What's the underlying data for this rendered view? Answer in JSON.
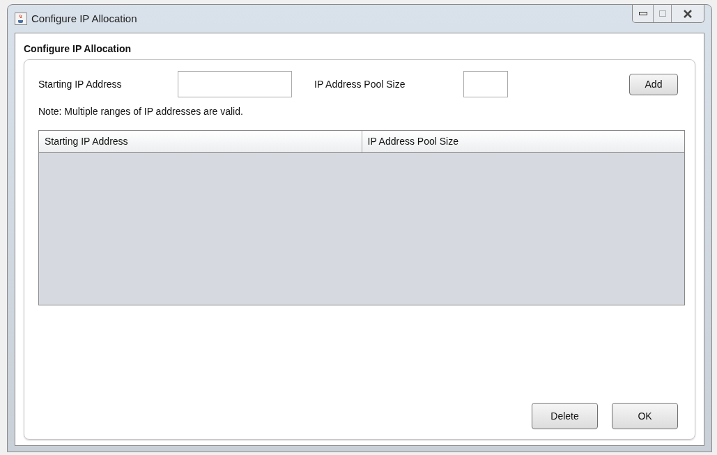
{
  "window": {
    "title": "Configure IP Allocation"
  },
  "panel": {
    "title": "Configure IP Allocation"
  },
  "form": {
    "start_label": "Starting IP Address",
    "pool_label": "IP Address Pool Size",
    "add_button": "Add",
    "note": "Note: Multiple ranges of IP addresses are valid."
  },
  "table": {
    "columns": [
      "Starting IP Address",
      "IP Address Pool Size"
    ]
  },
  "buttons": [
    "Delete",
    "OK"
  ]
}
